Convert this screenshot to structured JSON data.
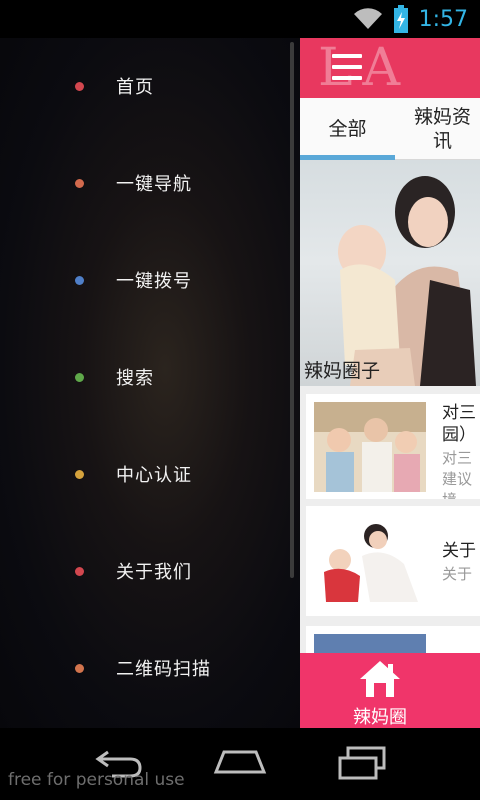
{
  "status_bar": {
    "time": "1:57",
    "wifi": "wifi-icon",
    "battery": "battery-icon"
  },
  "drawer": {
    "items": [
      {
        "label": "首页",
        "dot_color": "#d2474f"
      },
      {
        "label": "一键导航",
        "dot_color": "#d26a4d"
      },
      {
        "label": "一键拨号",
        "dot_color": "#4f7fc8"
      },
      {
        "label": "搜索",
        "dot_color": "#5fa84a"
      },
      {
        "label": "中心认证",
        "dot_color": "#d5a23c"
      },
      {
        "label": "关于我们",
        "dot_color": "#d2474f"
      },
      {
        "label": "二维码扫描",
        "dot_color": "#d2744d"
      }
    ]
  },
  "header": {
    "brand_partial": "LA",
    "accent": "#e8385f"
  },
  "tabs": [
    {
      "label": "全部",
      "selected": true
    },
    {
      "label": "辣妈资讯",
      "selected": false
    }
  ],
  "banner": {
    "caption": "辣妈圈子"
  },
  "news": [
    {
      "title": "对三",
      "title2": "园）",
      "subtitle": "对三",
      "subtitle2": "建议",
      "subtitle3": "境"
    },
    {
      "title": "关于",
      "subtitle": "关于"
    }
  ],
  "bottom_tab": {
    "label": "辣妈圈",
    "icon": "home-icon",
    "color": "#f0356a"
  },
  "nav_bar": {
    "back": "back-icon",
    "home": "home-nav-icon",
    "recents": "recents-icon",
    "watermark": "free for personal use"
  }
}
